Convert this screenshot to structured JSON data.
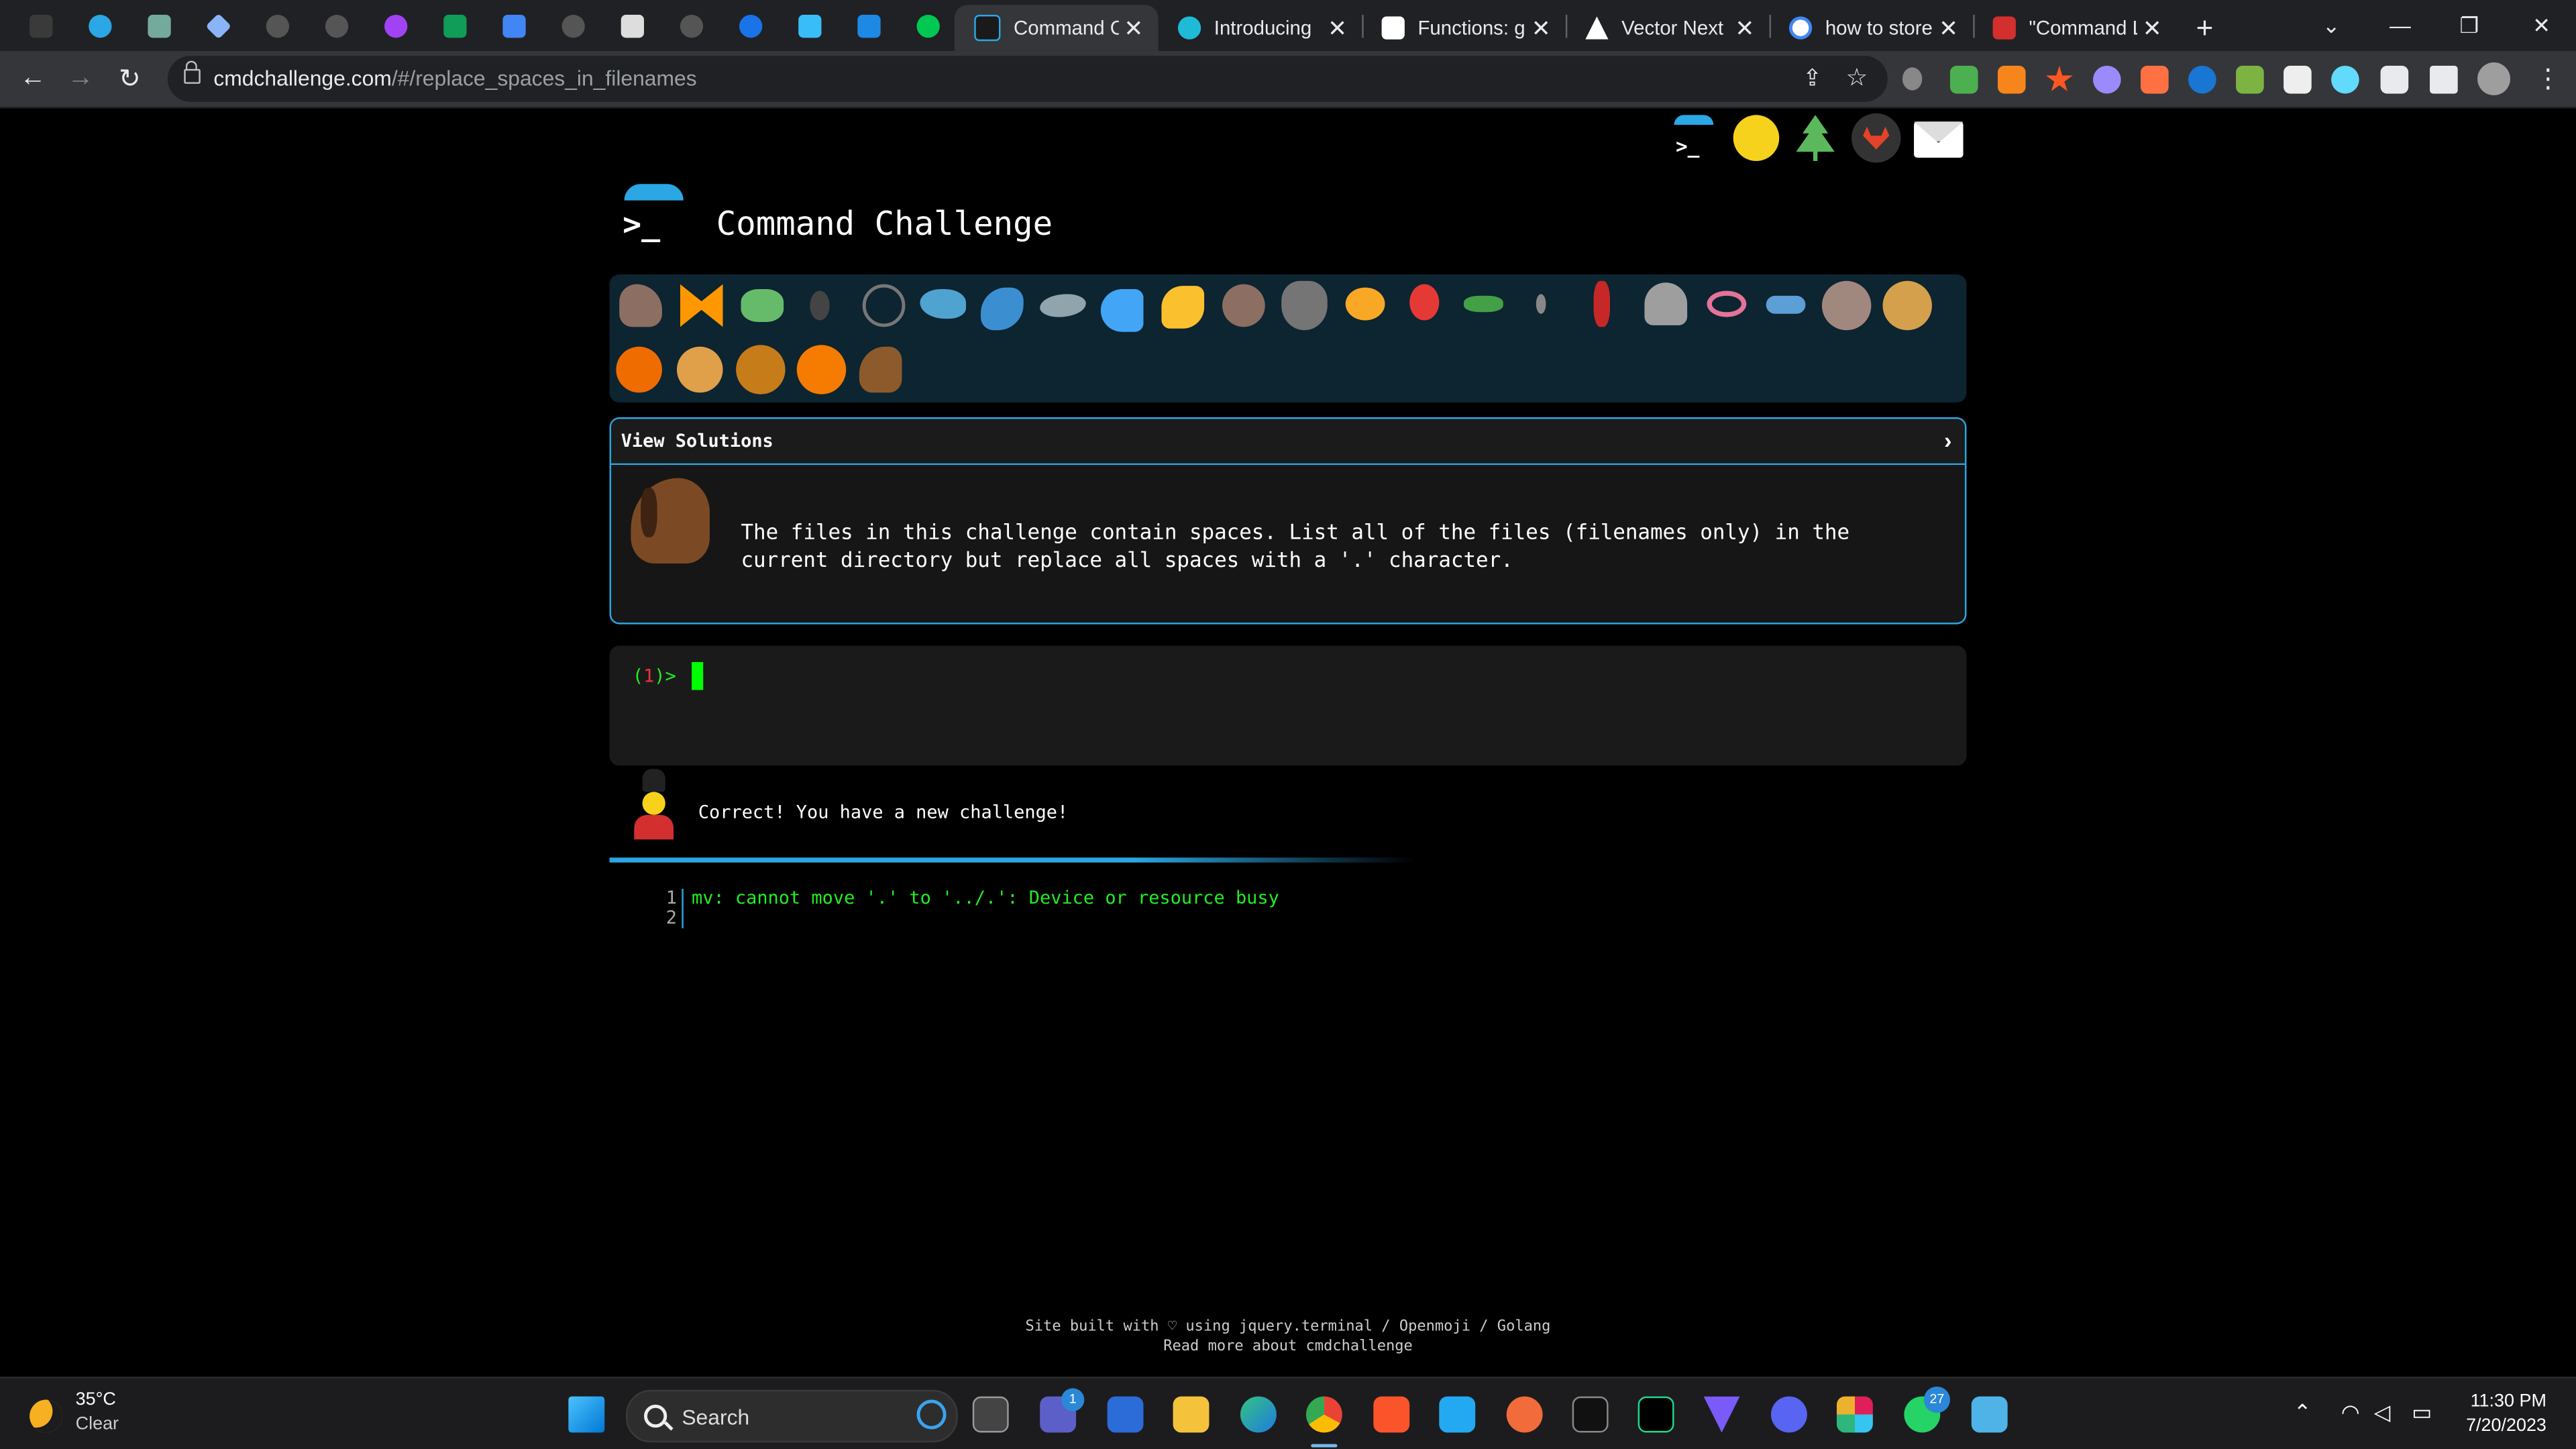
{
  "browser": {
    "tabs": [
      {
        "title": "Command Ch",
        "active": true
      },
      {
        "title": "Introducing"
      },
      {
        "title": "Functions: g"
      },
      {
        "title": "Vector Next"
      },
      {
        "title": "how to store"
      },
      {
        "title": "\"Command L"
      }
    ],
    "url_host": "cmdchallenge.com",
    "url_path": "/#/replace_spaces_in_filenames",
    "window_buttons": {
      "minimize": "—",
      "restore": "❐",
      "close": "✕"
    },
    "new_tab": "+",
    "tab_search": "⌄"
  },
  "page": {
    "title": "Command Challenge",
    "view_solutions_label": "View Solutions",
    "challenge_description": "The files in this challenge contain spaces. List all of the files (filenames only) in the current directory but replace all spaces with a '.' character.",
    "prompt_open": "(",
    "prompt_number": "1",
    "prompt_close": ")>",
    "status_message": "Correct! You have a new challenge!",
    "output_lines": [
      {
        "n": "1",
        "text": "mv: cannot move '.' to '../.': Device or resource busy"
      },
      {
        "n": "2",
        "text": ""
      }
    ],
    "footer_line1": "Site built with ♡ using jquery.terminal / Openmoji / Golang",
    "footer_line2": "Read more about cmdchallenge"
  },
  "taskbar": {
    "weather_temp": "35°C",
    "weather_desc": "Clear",
    "search_label": "Search",
    "time": "11:30 PM",
    "date": "7/20/2023",
    "teams_badge": "1",
    "whatsapp_badge": "27"
  }
}
